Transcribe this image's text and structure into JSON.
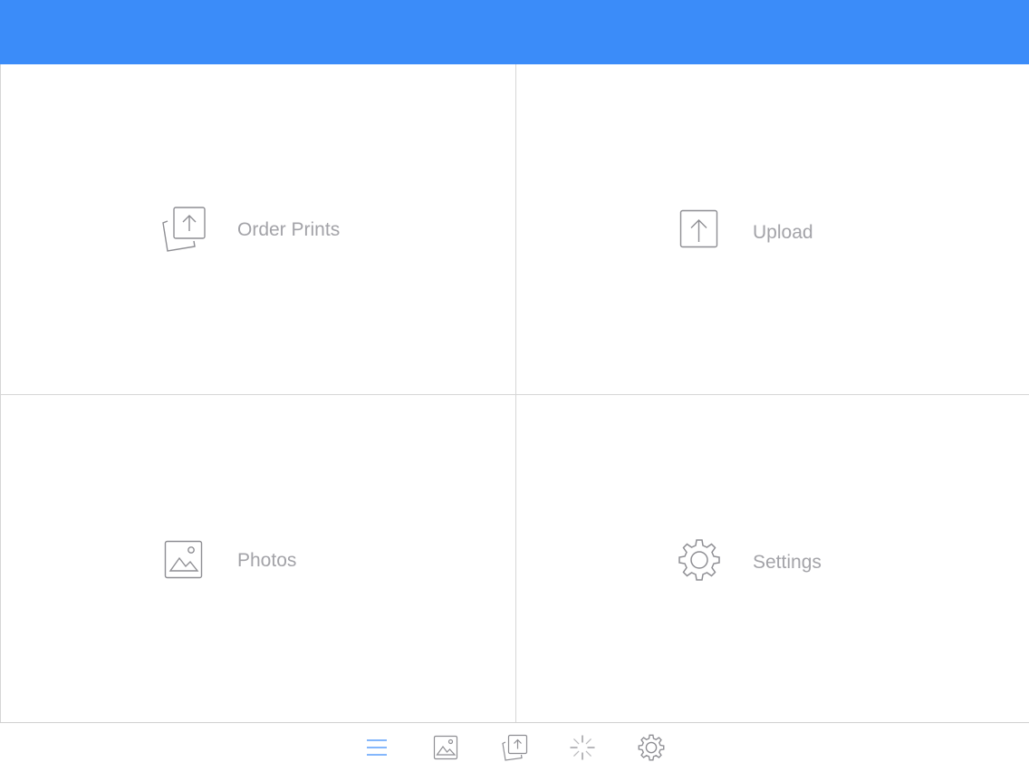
{
  "colors": {
    "accent": "#3b8cf9",
    "tile_label": "#a3a3a8",
    "icon_stroke": "#8e8e93",
    "divider": "#d6d6d6"
  },
  "menu": {
    "tiles": [
      {
        "label": "Order Prints",
        "icon": "order-prints-icon"
      },
      {
        "label": "Upload",
        "icon": "upload-icon"
      },
      {
        "label": "Photos",
        "icon": "photos-icon"
      },
      {
        "label": "Settings",
        "icon": "settings-icon"
      }
    ]
  },
  "tabbar": {
    "tabs": [
      {
        "icon": "menu-icon",
        "selected": true
      },
      {
        "icon": "photos-icon",
        "selected": false
      },
      {
        "icon": "order-prints-icon",
        "selected": false
      },
      {
        "icon": "activity-icon",
        "selected": false
      },
      {
        "icon": "settings-icon",
        "selected": false
      }
    ]
  }
}
